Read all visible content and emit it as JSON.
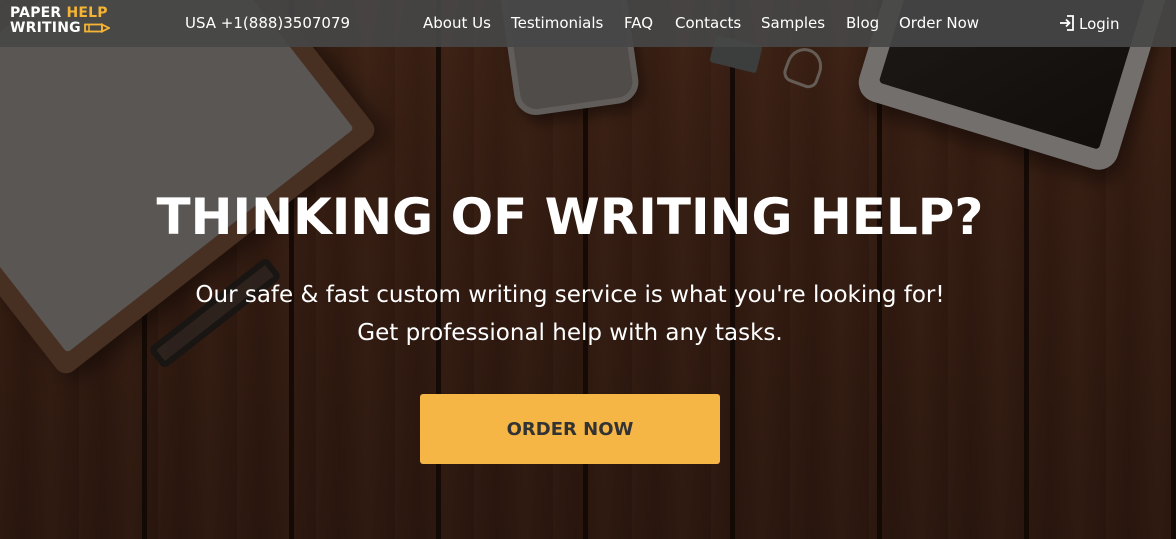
{
  "header": {
    "logo": {
      "line1_white": "PAPER ",
      "line1_accent": "HELP",
      "line2": "WRITING"
    },
    "phone": "USA +1(888)3507079",
    "nav": [
      "About Us",
      "Testimonials",
      "FAQ",
      "Contacts",
      "Samples",
      "Blog",
      "Order Now"
    ],
    "login_label": "Login"
  },
  "hero": {
    "title": "THINKING OF WRITING HELP?",
    "subtitle_line1": "Our safe & fast custom writing service is what you're looking for!",
    "subtitle_line2": "Get professional help with any tasks.",
    "cta_label": "ORDER NOW"
  },
  "colors": {
    "accent": "#f6b646",
    "navbar": "#464646",
    "logo_accent": "#f5b434",
    "text": "#ffffff",
    "cta_text": "#333333"
  },
  "icons": {
    "logo_mark": "pencil-icon",
    "login": "login-arrow-icon"
  }
}
